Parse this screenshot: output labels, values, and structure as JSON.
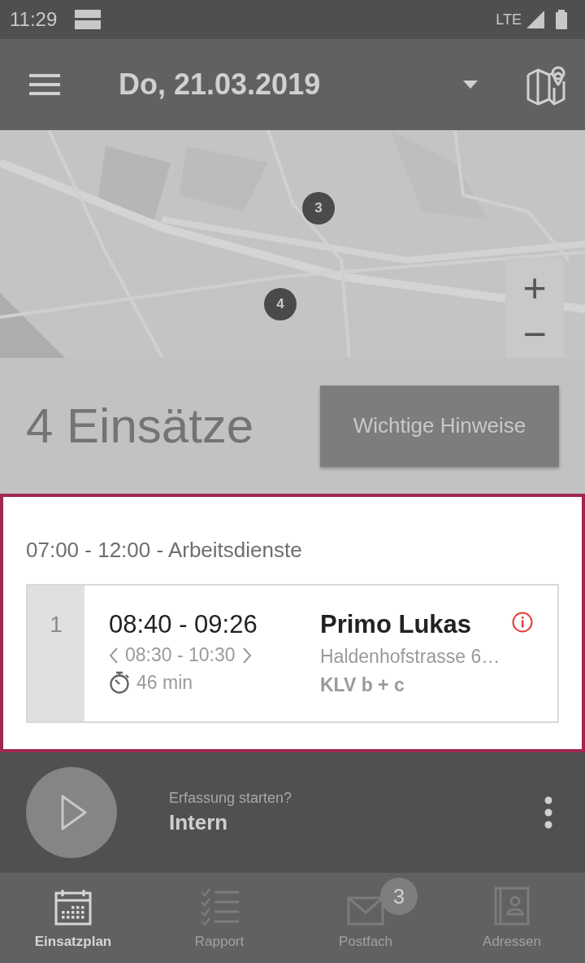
{
  "status_bar": {
    "time": "11:29",
    "network": "LTE"
  },
  "app_bar": {
    "date": "Do, 21.03.2019"
  },
  "map": {
    "kind": "picture",
    "markers": [
      {
        "label": "3"
      },
      {
        "label": "4"
      }
    ],
    "zoom_in": "+",
    "zoom_out": "−"
  },
  "summary": {
    "count": "4 Einsätze",
    "notes_button": "Wichtige Hinweise"
  },
  "shift": {
    "title": "07:00 - 12:00 - Arbeitsdienste",
    "highlighted": true,
    "assignments": [
      {
        "index": "1",
        "time": "08:40 - 09:26",
        "window": "08:30 - 10:30",
        "duration": "46 min",
        "name": "Primo Lukas",
        "address": "Haldenhofstrasse 6…",
        "service": "KLV b + c",
        "info": true
      }
    ]
  },
  "tracking": {
    "prompt": "Erfassung starten?",
    "label": "Intern"
  },
  "nav": [
    {
      "kind": "calendar",
      "label": "Einsatzplan",
      "selected": true
    },
    {
      "kind": "checklist",
      "label": "Rapport",
      "selected": false
    },
    {
      "kind": "mail",
      "label": "Postfach",
      "selected": false,
      "badge": "3"
    },
    {
      "kind": "contacts",
      "label": "Adressen",
      "selected": false
    }
  ]
}
